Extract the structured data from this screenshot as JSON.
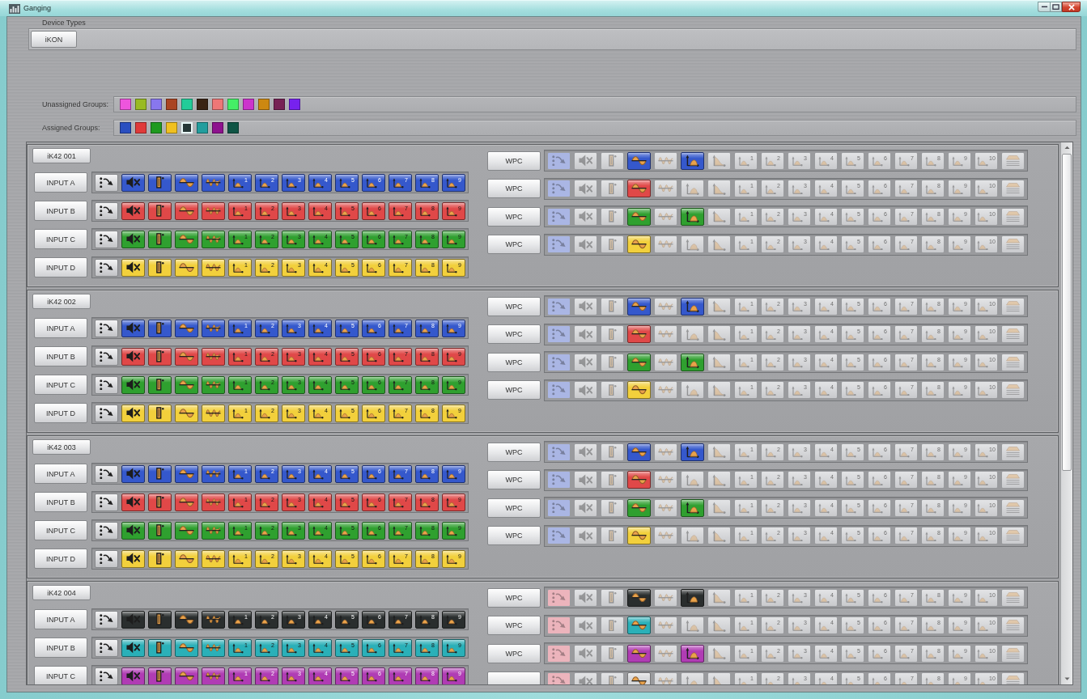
{
  "window": {
    "title": "Ganging"
  },
  "device_types": {
    "label": "Device Types",
    "buttons": [
      "iKON"
    ]
  },
  "unassigned_groups": {
    "label": "Unassigned Groups:",
    "swatches": [
      {
        "color": "#ee55dd"
      },
      {
        "color": "#99bb22"
      },
      {
        "color": "#8877ee"
      },
      {
        "color": "#aa4422"
      },
      {
        "color": "#22cc99"
      },
      {
        "color": "#3a2414"
      },
      {
        "color": "#ee7777"
      },
      {
        "color": "#44ee66"
      },
      {
        "color": "#cc33cc"
      },
      {
        "color": "#cc8811"
      },
      {
        "color": "#772255"
      },
      {
        "color": "#7722ee"
      }
    ]
  },
  "assigned_groups": {
    "label": "Assigned Groups:",
    "swatches": [
      {
        "color": "#2a4fc0",
        "selected": false
      },
      {
        "color": "#e03a3a",
        "selected": false
      },
      {
        "color": "#1f9a1f",
        "selected": false
      },
      {
        "color": "#f0c020",
        "selected": false
      },
      {
        "color": "#263636",
        "selected": true
      },
      {
        "color": "#229e9e",
        "selected": false
      },
      {
        "color": "#8e128e",
        "selected": false
      },
      {
        "color": "#0f5545",
        "selected": false
      }
    ]
  },
  "devices": [
    {
      "name": "iK42 001",
      "inputs": [
        {
          "label": "INPUT A",
          "color": "#3558cc",
          "mute_on": true,
          "bar_on": true,
          "wave_on": true,
          "dense_wave_on": true,
          "bands": [
            "1",
            "2",
            "3",
            "4",
            "5",
            "6",
            "7",
            "8",
            "9"
          ],
          "bands_on": true
        },
        {
          "label": "INPUT B",
          "color": "#e04848",
          "mute_on": true,
          "bar_on": true,
          "wave_on": true,
          "dense_wave_on": true,
          "bands": [
            "1",
            "2",
            "3",
            "4",
            "5",
            "6",
            "7",
            "8",
            "9"
          ],
          "bands_on": true
        },
        {
          "label": "INPUT C",
          "color": "#2fa02f",
          "mute_on": true,
          "bar_on": true,
          "wave_on": true,
          "dense_wave_on": true,
          "bands": [
            "1",
            "2",
            "3",
            "4",
            "5",
            "6",
            "7",
            "8",
            "9"
          ],
          "bands_on": true
        },
        {
          "label": "INPUT D",
          "color": "#f2d03c",
          "mute_on": true,
          "bar_on": true,
          "wave_on": true,
          "dense_wave_on": true,
          "bands": [
            "1",
            "2",
            "3",
            "4",
            "5",
            "6",
            "7",
            "8",
            "9"
          ],
          "bands_on": true
        }
      ],
      "outputs": [
        {
          "label": "WPC",
          "color": "#3558cc",
          "routing": {
            "color": "#aab6e4"
          },
          "mute_on": false,
          "bar_on": false,
          "wave_on": true,
          "dense_wave_on": false,
          "curve_on": true,
          "slope_on": false,
          "bands": [
            "1",
            "2",
            "3",
            "4",
            "5",
            "6",
            "7",
            "8",
            "9",
            "10"
          ],
          "bands_on": false,
          "lines_on": false
        },
        {
          "label": "WPC",
          "color": "#e04848",
          "routing": {
            "color": "#aab6e4"
          },
          "mute_on": false,
          "bar_on": false,
          "wave_on": true,
          "dense_wave_on": false,
          "curve_on": false,
          "slope_on": false,
          "bands": [
            "1",
            "2",
            "3",
            "4",
            "5",
            "6",
            "7",
            "8",
            "9",
            "10"
          ],
          "bands_on": false,
          "lines_on": false
        },
        {
          "label": "WPC",
          "color": "#2fa02f",
          "routing": {
            "color": "#aab6e4"
          },
          "mute_on": false,
          "bar_on": false,
          "wave_on": true,
          "dense_wave_on": false,
          "curve_on": true,
          "slope_on": false,
          "bands": [
            "1",
            "2",
            "3",
            "4",
            "5",
            "6",
            "7",
            "8",
            "9",
            "10"
          ],
          "bands_on": false,
          "lines_on": false
        },
        {
          "label": "WPC",
          "color": "#f2d03c",
          "routing": {
            "color": "#aab6e4"
          },
          "mute_on": false,
          "bar_on": false,
          "wave_on": true,
          "dense_wave_on": false,
          "curve_on": false,
          "slope_on": false,
          "bands": [
            "1",
            "2",
            "3",
            "4",
            "5",
            "6",
            "7",
            "8",
            "9",
            "10"
          ],
          "bands_on": false,
          "lines_on": false
        }
      ]
    },
    {
      "name": "iK42 002",
      "inputs": [
        {
          "label": "INPUT A",
          "color": "#3558cc",
          "mute_on": true,
          "bar_on": true,
          "wave_on": true,
          "dense_wave_on": true,
          "bands": [
            "1",
            "2",
            "3",
            "4",
            "5",
            "6",
            "7",
            "8",
            "9"
          ],
          "bands_on": true
        },
        {
          "label": "INPUT B",
          "color": "#e04848",
          "mute_on": true,
          "bar_on": true,
          "wave_on": true,
          "dense_wave_on": true,
          "bands": [
            "1",
            "2",
            "3",
            "4",
            "5",
            "6",
            "7",
            "8",
            "9"
          ],
          "bands_on": true
        },
        {
          "label": "INPUT C",
          "color": "#2fa02f",
          "mute_on": true,
          "bar_on": true,
          "wave_on": true,
          "dense_wave_on": true,
          "bands": [
            "1",
            "2",
            "3",
            "4",
            "5",
            "6",
            "7",
            "8",
            "9"
          ],
          "bands_on": true
        },
        {
          "label": "INPUT D",
          "color": "#f2d03c",
          "mute_on": true,
          "bar_on": true,
          "wave_on": true,
          "dense_wave_on": true,
          "bands": [
            "1",
            "2",
            "3",
            "4",
            "5",
            "6",
            "7",
            "8",
            "9"
          ],
          "bands_on": true
        }
      ],
      "outputs": [
        {
          "label": "WPC",
          "color": "#3558cc",
          "routing": {
            "color": "#aab6e4"
          },
          "mute_on": false,
          "bar_on": false,
          "wave_on": true,
          "dense_wave_on": false,
          "curve_on": true,
          "slope_on": false,
          "bands": [
            "1",
            "2",
            "3",
            "4",
            "5",
            "6",
            "7",
            "8",
            "9",
            "10"
          ],
          "bands_on": false,
          "lines_on": false
        },
        {
          "label": "WPC",
          "color": "#e04848",
          "routing": {
            "color": "#aab6e4"
          },
          "mute_on": false,
          "bar_on": false,
          "wave_on": true,
          "dense_wave_on": false,
          "curve_on": false,
          "slope_on": false,
          "bands": [
            "1",
            "2",
            "3",
            "4",
            "5",
            "6",
            "7",
            "8",
            "9",
            "10"
          ],
          "bands_on": false,
          "lines_on": false
        },
        {
          "label": "WPC",
          "color": "#2fa02f",
          "routing": {
            "color": "#aab6e4"
          },
          "mute_on": false,
          "bar_on": false,
          "wave_on": true,
          "dense_wave_on": false,
          "curve_on": true,
          "slope_on": false,
          "bands": [
            "1",
            "2",
            "3",
            "4",
            "5",
            "6",
            "7",
            "8",
            "9",
            "10"
          ],
          "bands_on": false,
          "lines_on": false
        },
        {
          "label": "WPC",
          "color": "#f2d03c",
          "routing": {
            "color": "#aab6e4"
          },
          "mute_on": false,
          "bar_on": false,
          "wave_on": true,
          "dense_wave_on": false,
          "curve_on": false,
          "slope_on": false,
          "bands": [
            "1",
            "2",
            "3",
            "4",
            "5",
            "6",
            "7",
            "8",
            "9",
            "10"
          ],
          "bands_on": false,
          "lines_on": false
        }
      ]
    },
    {
      "name": "iK42 003",
      "inputs": [
        {
          "label": "INPUT A",
          "color": "#3558cc",
          "mute_on": true,
          "bar_on": true,
          "wave_on": true,
          "dense_wave_on": true,
          "bands": [
            "1",
            "2",
            "3",
            "4",
            "5",
            "6",
            "7",
            "8",
            "9"
          ],
          "bands_on": true
        },
        {
          "label": "INPUT B",
          "color": "#e04848",
          "mute_on": true,
          "bar_on": true,
          "wave_on": true,
          "dense_wave_on": true,
          "bands": [
            "1",
            "2",
            "3",
            "4",
            "5",
            "6",
            "7",
            "8",
            "9"
          ],
          "bands_on": true
        },
        {
          "label": "INPUT C",
          "color": "#2fa02f",
          "mute_on": true,
          "bar_on": true,
          "wave_on": true,
          "dense_wave_on": true,
          "bands": [
            "1",
            "2",
            "3",
            "4",
            "5",
            "6",
            "7",
            "8",
            "9"
          ],
          "bands_on": true
        },
        {
          "label": "INPUT D",
          "color": "#f2d03c",
          "mute_on": true,
          "bar_on": true,
          "wave_on": true,
          "dense_wave_on": true,
          "bands": [
            "1",
            "2",
            "3",
            "4",
            "5",
            "6",
            "7",
            "8",
            "9"
          ],
          "bands_on": true
        }
      ],
      "outputs": [
        {
          "label": "WPC",
          "color": "#3558cc",
          "routing": {
            "color": "#aab6e4"
          },
          "mute_on": false,
          "bar_on": false,
          "wave_on": true,
          "dense_wave_on": false,
          "curve_on": true,
          "slope_on": false,
          "bands": [
            "1",
            "2",
            "3",
            "4",
            "5",
            "6",
            "7",
            "8",
            "9",
            "10"
          ],
          "bands_on": false,
          "lines_on": false
        },
        {
          "label": "WPC",
          "color": "#e04848",
          "routing": {
            "color": "#aab6e4"
          },
          "mute_on": false,
          "bar_on": false,
          "wave_on": true,
          "dense_wave_on": false,
          "curve_on": false,
          "slope_on": false,
          "bands": [
            "1",
            "2",
            "3",
            "4",
            "5",
            "6",
            "7",
            "8",
            "9",
            "10"
          ],
          "bands_on": false,
          "lines_on": false
        },
        {
          "label": "WPC",
          "color": "#2fa02f",
          "routing": {
            "color": "#aab6e4"
          },
          "mute_on": false,
          "bar_on": false,
          "wave_on": true,
          "dense_wave_on": false,
          "curve_on": true,
          "slope_on": false,
          "bands": [
            "1",
            "2",
            "3",
            "4",
            "5",
            "6",
            "7",
            "8",
            "9",
            "10"
          ],
          "bands_on": false,
          "lines_on": false
        },
        {
          "label": "WPC",
          "color": "#f2d03c",
          "routing": {
            "color": "#aab6e4"
          },
          "mute_on": false,
          "bar_on": false,
          "wave_on": true,
          "dense_wave_on": false,
          "curve_on": false,
          "slope_on": false,
          "bands": [
            "1",
            "2",
            "3",
            "4",
            "5",
            "6",
            "7",
            "8",
            "9",
            "10"
          ],
          "bands_on": false,
          "lines_on": false
        }
      ]
    },
    {
      "name": "iK42 004",
      "inputs": [
        {
          "label": "INPUT A",
          "color": "#2a2e2e",
          "mute_on": true,
          "bar_on": true,
          "wave_on": true,
          "dense_wave_on": true,
          "bands": [
            "1",
            "2",
            "3",
            "4",
            "5",
            "6",
            "7",
            "8",
            "9"
          ],
          "bands_on": true
        },
        {
          "label": "INPUT B",
          "color": "#2ab0b8",
          "mute_on": true,
          "bar_on": true,
          "wave_on": true,
          "dense_wave_on": true,
          "bands": [
            "1",
            "2",
            "3",
            "4",
            "5",
            "6",
            "7",
            "8",
            "9"
          ],
          "bands_on": true
        },
        {
          "label": "INPUT C",
          "color": "#b03cb4",
          "mute_on": true,
          "bar_on": true,
          "wave_on": true,
          "dense_wave_on": true,
          "bands": [
            "1",
            "2",
            "3",
            "4",
            "5",
            "6",
            "7",
            "8",
            "9"
          ],
          "bands_on": true
        }
      ],
      "outputs": [
        {
          "label": "WPC",
          "color": "#2a2e2e",
          "routing": {
            "color": "#ecb4bc"
          },
          "mute_on": false,
          "bar_on": false,
          "wave_on": true,
          "dense_wave_on": false,
          "curve_on": true,
          "slope_on": false,
          "bands": [
            "1",
            "2",
            "3",
            "4",
            "5",
            "6",
            "7",
            "8",
            "9",
            "10"
          ],
          "bands_on": false,
          "lines_on": false
        },
        {
          "label": "WPC",
          "color": "#2ab0b8",
          "routing": {
            "color": "#ecb4bc"
          },
          "mute_on": false,
          "bar_on": false,
          "wave_on": true,
          "dense_wave_on": false,
          "curve_on": false,
          "slope_on": false,
          "bands": [
            "1",
            "2",
            "3",
            "4",
            "5",
            "6",
            "7",
            "8",
            "9",
            "10"
          ],
          "bands_on": false,
          "lines_on": false
        },
        {
          "label": "WPC",
          "color": "#b03cb4",
          "routing": {
            "color": "#ecb4bc"
          },
          "mute_on": false,
          "bar_on": false,
          "wave_on": true,
          "dense_wave_on": false,
          "curve_on": true,
          "slope_on": false,
          "bands": [
            "1",
            "2",
            "3",
            "4",
            "5",
            "6",
            "7",
            "8",
            "9",
            "10"
          ],
          "bands_on": false,
          "lines_on": false
        },
        {
          "routing": {
            "color": "#ecb4bc"
          },
          "mute_on": false,
          "bar_on": false,
          "wave_on": true,
          "dense_wave_on": false,
          "curve_on": false,
          "slope_on": false,
          "bands": [
            "1",
            "2",
            "3",
            "4",
            "5",
            "6",
            "7",
            "8",
            "9",
            "10"
          ],
          "bands_on": false,
          "lines_on": false
        }
      ]
    }
  ]
}
